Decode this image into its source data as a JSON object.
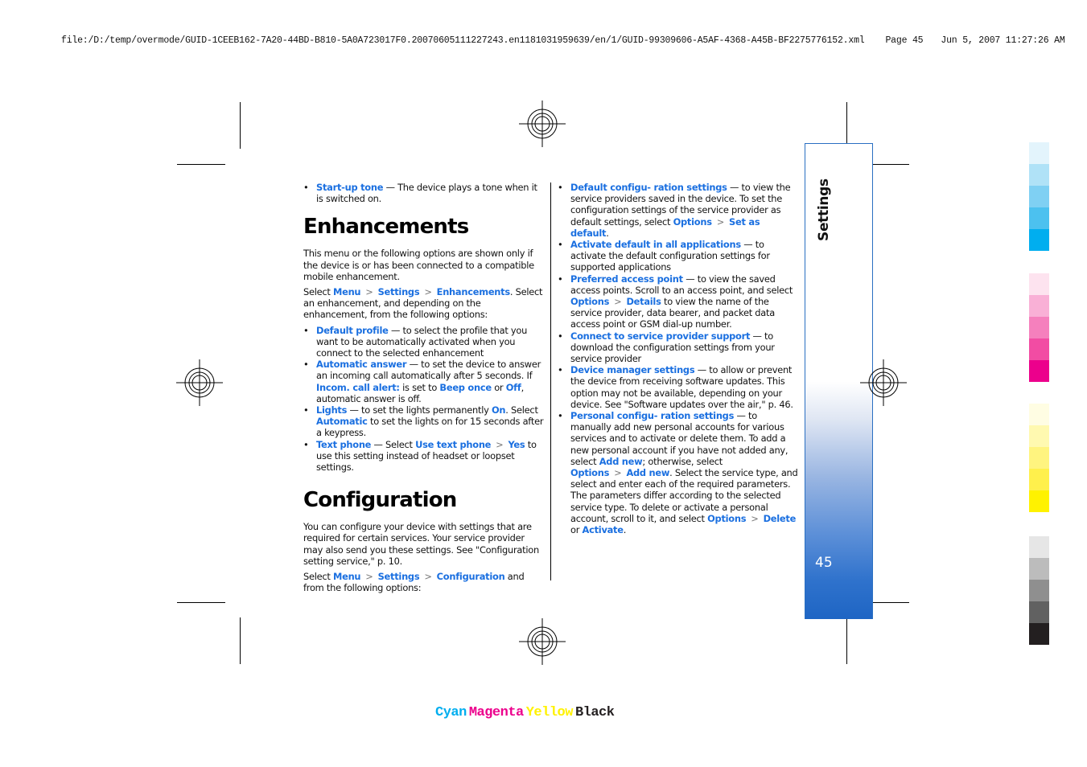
{
  "print_header": {
    "file_path": "file:/D:/temp/overmode/GUID-1CEEB162-7A20-44BD-B810-5A0A723017F0.20070605111227243.en1181031959639/en/1/GUID-99309606-A5AF-4368-A45B-BF2275776152.xml",
    "page_label": "Page 45",
    "timestamp": "Jun 5, 2007 11:27:26 AM"
  },
  "separator_glyph": ">",
  "left_column": {
    "startup_item": {
      "term": "Start-up tone",
      "text": " — The device plays a tone when it is switched on."
    },
    "enhancements": {
      "heading": "Enhancements",
      "intro": "This menu or the following options are shown only if the device is or has been connected to a compatible mobile enhancement.",
      "select_prefix": "Select ",
      "path": [
        "Menu",
        "Settings",
        "Enhancements"
      ],
      "select_suffix": ". Select an enhancement, and depending on the enhancement, from the following options:",
      "items": [
        {
          "term": "Default profile",
          "text": " — to select the profile that you want to be automatically activated when you connect to the selected enhancement"
        },
        {
          "term": "Automatic answer",
          "text": " — to set the device to answer an incoming call automatically after 5 seconds. If ",
          "term2": "Incom. call alert:",
          "text2": " is set to ",
          "term3": "Beep once",
          "text3": " or ",
          "term4": "Off",
          "text4": ", automatic answer is off."
        },
        {
          "term": "Lights",
          "text": " — to set the lights permanently ",
          "term2": "On",
          "text2": ". Select ",
          "term3": "Automatic",
          "text3": " to set the lights on for 15 seconds after a keypress."
        },
        {
          "term": "Text phone",
          "text": " — Select ",
          "term2": "Use text phone",
          "term3": "Yes",
          "text3": " to use this setting instead of headset or loopset settings."
        }
      ]
    },
    "configuration": {
      "heading": "Configuration",
      "intro": "You can configure your device with settings that are required for certain services. Your service provider may also send you these settings. See \"Configuration setting service,\" p. 10.",
      "select_prefix": "Select ",
      "path": [
        "Menu",
        "Settings",
        "Configuration"
      ],
      "select_suffix": " and from the following options:"
    }
  },
  "right_column": {
    "items": [
      {
        "term": "Default configu- ration settings",
        "text": " — to view the service providers saved in the device. To set the configuration settings of the service provider as default settings, select ",
        "term2": "Options",
        "term3": "Set as default",
        "text3": "."
      },
      {
        "term": "Activate default in all applications",
        "text": " — to activate the default configuration settings for supported applications"
      },
      {
        "term": "Preferred access point",
        "text": " — to view the saved access points. Scroll to an access point, and select ",
        "term2": "Options",
        "term3": "Details",
        "text3": " to view the name of the service provider, data bearer, and packet data access point or GSM dial-up number."
      },
      {
        "term": "Connect to service provider support",
        "text": " — to download the configuration settings from your service provider"
      },
      {
        "term": "Device manager settings",
        "text": " — to allow or prevent the device from receiving software updates. This option may not be available, depending on your device. See \"Software updates over the air,\" p. 46."
      },
      {
        "term": "Personal configu- ration settings",
        "text": " — to manually add new personal accounts for various services and to activate or delete them. To add a new personal account if you have not added any, select ",
        "term2": "Add new",
        "text2": "; otherwise, select ",
        "term3": "Options",
        "term4": "Add new",
        "text4": ". Select the service type, and select and enter each of the required parameters. The parameters differ according to the selected service type. To delete or activate a personal account, scroll to it, and select ",
        "term5": "Options",
        "term6": "Delete",
        "text6": " or ",
        "term7": "Activate",
        "text7": "."
      }
    ]
  },
  "side_tab": {
    "title": "Settings",
    "page_number": "45"
  },
  "color_bars": {
    "cyan": [
      "#e3f4fc",
      "#b0e2f7",
      "#7fd0f3",
      "#4cc1ef",
      "#00aeef"
    ],
    "magenta": [
      "#fde3ef",
      "#f9b0d6",
      "#f580bd",
      "#f24ca3",
      "#ec008c"
    ],
    "yellow": [
      "#fffde3",
      "#fff9b0",
      "#fff47f",
      "#fff04c",
      "#fff200"
    ],
    "black": [
      "#e6e6e6",
      "#bcbcbc",
      "#8f8f8f",
      "#616161",
      "#231f20"
    ]
  },
  "color_label": {
    "cyan": {
      "text": "Cyan",
      "color": "#00aeef"
    },
    "magenta": {
      "text": "Magenta",
      "color": "#ec008c"
    },
    "yellow": {
      "text": "Yellow",
      "color": "#fff200"
    },
    "black": {
      "text": "Black",
      "color": "#231f20"
    }
  },
  "accent_color": "#1a6fe0"
}
